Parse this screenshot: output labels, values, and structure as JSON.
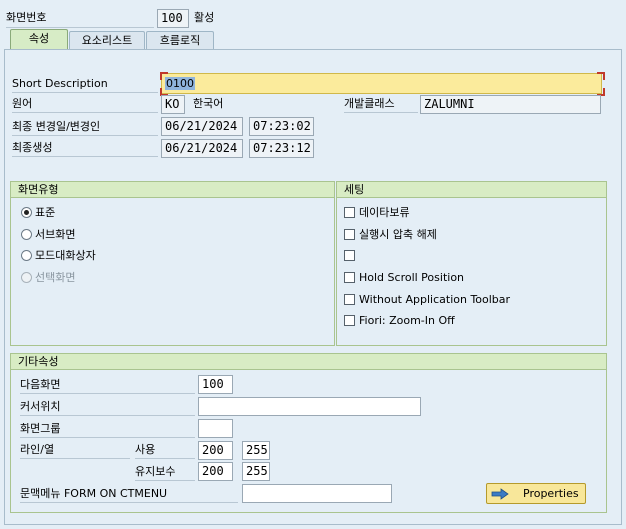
{
  "header": {
    "screen_number_label": "화면번호",
    "screen_number": "100",
    "status": "활성"
  },
  "tabs": [
    {
      "label": "속성",
      "active": true
    },
    {
      "label": "요소리스트",
      "active": false
    },
    {
      "label": "흐름로직",
      "active": false
    }
  ],
  "attributes": {
    "short_desc_label": "Short Description",
    "short_desc_value": "0100",
    "language_label": "원어",
    "language_code": "KO",
    "language_name": "한국어",
    "dev_class_label": "개발클래스",
    "dev_class_value": "ZALUMNI",
    "last_changed_label": "최종 변경일/변경인",
    "last_changed_date": "06/21/2024",
    "last_changed_time": "07:23:02",
    "last_generated_label": "최종생성",
    "last_generated_date": "06/21/2024",
    "last_generated_time": "07:23:12"
  },
  "screen_type": {
    "title": "화면유형",
    "options": [
      {
        "label": "표준",
        "selected": true,
        "disabled": false
      },
      {
        "label": "서브화면",
        "selected": false,
        "disabled": false
      },
      {
        "label": "모드대화상자",
        "selected": false,
        "disabled": false
      },
      {
        "label": "선택화면",
        "selected": false,
        "disabled": true
      }
    ]
  },
  "settings": {
    "title": "세팅",
    "checkboxes": [
      {
        "label": "데이타보류",
        "checked": false
      },
      {
        "label": "실행시 압축 해제",
        "checked": false
      },
      {
        "label": "",
        "checked": false
      },
      {
        "label": "Hold Scroll Position",
        "checked": false
      },
      {
        "label": "Without Application Toolbar",
        "checked": false
      },
      {
        "label": "Fiori: Zoom-In Off",
        "checked": false
      }
    ]
  },
  "other": {
    "title": "기타속성",
    "next_screen_label": "다음화면",
    "next_screen_value": "100",
    "cursor_pos_label": "커서위치",
    "cursor_pos_value": "",
    "screen_group_label": "화면그룹",
    "screen_group_value": "",
    "lines_cols_label": "라인/열",
    "used_label": "사용",
    "used_lines": "200",
    "used_cols": "255",
    "maintenance_label": "유지보수",
    "maint_lines": "200",
    "maint_cols": "255",
    "context_menu_label": "문맥메뉴 FORM ON CTMENU",
    "context_menu_value": "",
    "properties_button": "Properties"
  },
  "colors": {
    "background": "#e4eef6",
    "active_tab": "#d7ecc6",
    "group_header": "#d8ecc4",
    "highlight_field": "#fbeb9c",
    "button": "#f8e79a"
  }
}
